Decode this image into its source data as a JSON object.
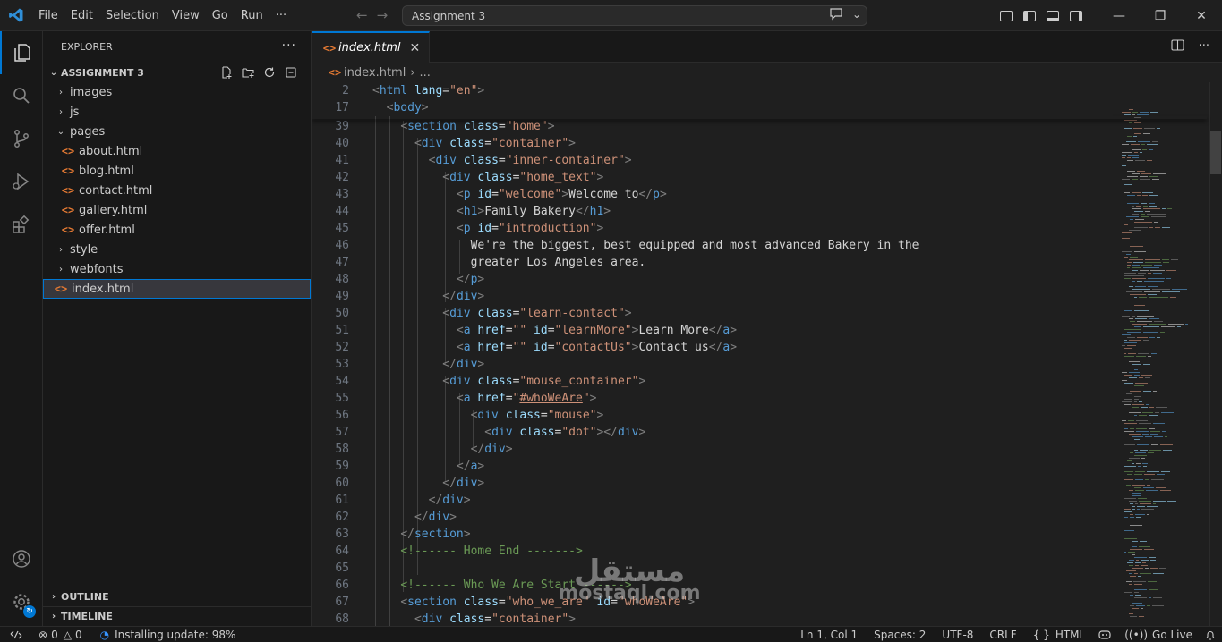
{
  "menu": [
    "File",
    "Edit",
    "Selection",
    "View",
    "Go",
    "Run",
    "···"
  ],
  "command_center": {
    "text": "Assignment 3"
  },
  "sidebar": {
    "title": "EXPLORER",
    "more": "···",
    "workspace": "ASSIGNMENT 3",
    "tree": [
      {
        "label": "images",
        "kind": "folder",
        "depth": 1
      },
      {
        "label": "js",
        "kind": "folder",
        "depth": 1
      },
      {
        "label": "pages",
        "kind": "folder-open",
        "depth": 1
      },
      {
        "label": "about.html",
        "kind": "html",
        "depth": 2
      },
      {
        "label": "blog.html",
        "kind": "html",
        "depth": 2
      },
      {
        "label": "contact.html",
        "kind": "html",
        "depth": 2
      },
      {
        "label": "gallery.html",
        "kind": "html",
        "depth": 2
      },
      {
        "label": "offer.html",
        "kind": "html",
        "depth": 2
      },
      {
        "label": "style",
        "kind": "folder",
        "depth": 1
      },
      {
        "label": "webfonts",
        "kind": "folder",
        "depth": 1
      },
      {
        "label": "index.html",
        "kind": "html",
        "depth": 1,
        "selected": true
      }
    ],
    "outline": "OUTLINE",
    "timeline": "TIMELINE"
  },
  "editor": {
    "tab": "index.html",
    "breadcrumb_file": "index.html",
    "breadcrumb_more": "...",
    "sticky": [
      {
        "ln": "2",
        "html": "<span class='t'>&lt;</span><span class='n'>html</span> <span class='a'>lang</span><span class='x'>=</span><span class='s'>\"en\"</span><span class='t'>&gt;</span>"
      },
      {
        "ln": "17",
        "html": "  <span class='t'>&lt;</span><span class='n'>body</span><span class='t'>&gt;</span>"
      }
    ],
    "lines": [
      {
        "ln": "39",
        "html": "    <span class='t'>&lt;</span><span class='n'>section</span> <span class='a'>class</span><span class='x'>=</span><span class='s'>\"home\"</span><span class='t'>&gt;</span>"
      },
      {
        "ln": "40",
        "html": "      <span class='t'>&lt;</span><span class='n'>div</span> <span class='a'>class</span><span class='x'>=</span><span class='s'>\"container\"</span><span class='t'>&gt;</span>"
      },
      {
        "ln": "41",
        "html": "        <span class='t'>&lt;</span><span class='n'>div</span> <span class='a'>class</span><span class='x'>=</span><span class='s'>\"inner-container\"</span><span class='t'>&gt;</span>"
      },
      {
        "ln": "42",
        "html": "          <span class='t'>&lt;</span><span class='n'>div</span> <span class='a'>class</span><span class='x'>=</span><span class='s'>\"home_text\"</span><span class='t'>&gt;</span>"
      },
      {
        "ln": "43",
        "html": "            <span class='t'>&lt;</span><span class='n'>p</span> <span class='a'>id</span><span class='x'>=</span><span class='s'>\"welcome\"</span><span class='t'>&gt;</span><span class='x'>Welcome to</span><span class='t'>&lt;/</span><span class='n'>p</span><span class='t'>&gt;</span>"
      },
      {
        "ln": "44",
        "html": "            <span class='t'>&lt;</span><span class='n'>h1</span><span class='t'>&gt;</span><span class='x'>Family Bakery</span><span class='t'>&lt;/</span><span class='n'>h1</span><span class='t'>&gt;</span>"
      },
      {
        "ln": "45",
        "html": "            <span class='t'>&lt;</span><span class='n'>p</span> <span class='a'>id</span><span class='x'>=</span><span class='s'>\"introduction\"</span><span class='t'>&gt;</span>"
      },
      {
        "ln": "46",
        "html": "              <span class='x'>We're the biggest, best equipped and most advanced Bakery in the</span>"
      },
      {
        "ln": "47",
        "html": "              <span class='x'>greater Los Angeles area.</span>"
      },
      {
        "ln": "48",
        "html": "            <span class='t'>&lt;/</span><span class='n'>p</span><span class='t'>&gt;</span>"
      },
      {
        "ln": "49",
        "html": "          <span class='t'>&lt;/</span><span class='n'>div</span><span class='t'>&gt;</span>"
      },
      {
        "ln": "50",
        "html": "          <span class='t'>&lt;</span><span class='n'>div</span> <span class='a'>class</span><span class='x'>=</span><span class='s'>\"learn-contact\"</span><span class='t'>&gt;</span>"
      },
      {
        "ln": "51",
        "html": "            <span class='t'>&lt;</span><span class='n'>a</span> <span class='a'>href</span><span class='x'>=</span><span class='s'>\"\"</span> <span class='a'>id</span><span class='x'>=</span><span class='s'>\"learnMore\"</span><span class='t'>&gt;</span><span class='x'>Learn More</span><span class='t'>&lt;/</span><span class='n'>a</span><span class='t'>&gt;</span>"
      },
      {
        "ln": "52",
        "html": "            <span class='t'>&lt;</span><span class='n'>a</span> <span class='a'>href</span><span class='x'>=</span><span class='s'>\"\"</span> <span class='a'>id</span><span class='x'>=</span><span class='s'>\"contactUs\"</span><span class='t'>&gt;</span><span class='x'>Contact us</span><span class='t'>&lt;/</span><span class='n'>a</span><span class='t'>&gt;</span>"
      },
      {
        "ln": "53",
        "html": "          <span class='t'>&lt;/</span><span class='n'>div</span><span class='t'>&gt;</span>"
      },
      {
        "ln": "54",
        "html": "          <span class='t'>&lt;</span><span class='n'>div</span> <span class='a'>class</span><span class='x'>=</span><span class='s'>\"mouse_container\"</span><span class='t'>&gt;</span>"
      },
      {
        "ln": "55",
        "html": "            <span class='t'>&lt;</span><span class='n'>a</span> <span class='a'>href</span><span class='x'>=</span><span class='s'>\"<span class='u'>#whoWeAre</span>\"</span><span class='t'>&gt;</span>"
      },
      {
        "ln": "56",
        "html": "              <span class='t'>&lt;</span><span class='n'>div</span> <span class='a'>class</span><span class='x'>=</span><span class='s'>\"mouse\"</span><span class='t'>&gt;</span>"
      },
      {
        "ln": "57",
        "html": "                <span class='t'>&lt;</span><span class='n'>div</span> <span class='a'>class</span><span class='x'>=</span><span class='s'>\"dot\"</span><span class='t'>&gt;&lt;/</span><span class='n'>div</span><span class='t'>&gt;</span>"
      },
      {
        "ln": "58",
        "html": "              <span class='t'>&lt;/</span><span class='n'>div</span><span class='t'>&gt;</span>"
      },
      {
        "ln": "59",
        "html": "            <span class='t'>&lt;/</span><span class='n'>a</span><span class='t'>&gt;</span>"
      },
      {
        "ln": "60",
        "html": "          <span class='t'>&lt;/</span><span class='n'>div</span><span class='t'>&gt;</span>"
      },
      {
        "ln": "61",
        "html": "        <span class='t'>&lt;/</span><span class='n'>div</span><span class='t'>&gt;</span>"
      },
      {
        "ln": "62",
        "html": "      <span class='t'>&lt;/</span><span class='n'>div</span><span class='t'>&gt;</span>"
      },
      {
        "ln": "63",
        "html": "    <span class='t'>&lt;/</span><span class='n'>section</span><span class='t'>&gt;</span>"
      },
      {
        "ln": "64",
        "html": "    <span class='c'>&lt;!------ Home End -------&gt;</span>"
      },
      {
        "ln": "65",
        "html": ""
      },
      {
        "ln": "66",
        "html": "    <span class='c'>&lt;!------ Who We Are Start ------&gt;</span>"
      },
      {
        "ln": "67",
        "html": "    <span class='t'>&lt;</span><span class='n'>section</span> <span class='a'>class</span><span class='x'>=</span><span class='s'>\"who_we_are\"</span> <span class='a'>id</span><span class='x'>=</span><span class='s'>\"whoWeAre\"</span><span class='t'>&gt;</span>"
      },
      {
        "ln": "68",
        "html": "      <span class='t'>&lt;</span><span class='n'>div</span> <span class='a'>class</span><span class='x'>=</span><span class='s'>\"container\"</span><span class='t'>&gt;</span>"
      }
    ]
  },
  "statusbar": {
    "errors": "0",
    "warnings": "0",
    "update": "Installing update: 98%",
    "position": "Ln 1, Col 1",
    "spaces": "Spaces: 2",
    "encoding": "UTF-8",
    "eol": "CRLF",
    "language": "HTML",
    "golive": "Go Live"
  },
  "watermark": {
    "arabic": "مستقل",
    "latin": "mostaql.com"
  },
  "colors": {
    "accent": "#0078d4",
    "html_icon": "#e37933",
    "tag": "#569cd6",
    "attr": "#9cdcfe",
    "string": "#ce9178",
    "comment": "#6a9955"
  }
}
